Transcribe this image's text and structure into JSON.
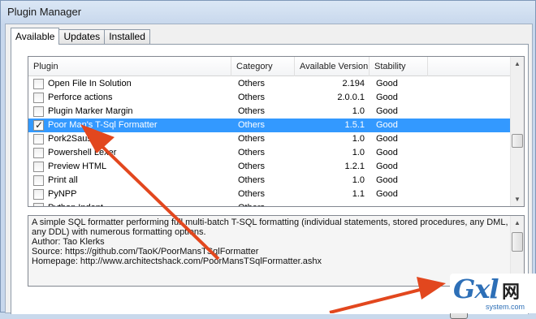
{
  "window": {
    "title": "Plugin Manager"
  },
  "tabs": [
    {
      "label": "Available",
      "active": true
    },
    {
      "label": "Updates",
      "active": false
    },
    {
      "label": "Installed",
      "active": false
    }
  ],
  "columns": [
    "Plugin",
    "Category",
    "Available Version",
    "Stability"
  ],
  "plugins": [
    {
      "name": "Open File In Solution",
      "category": "Others",
      "version": "2.194",
      "stability": "Good",
      "checked": false,
      "selected": false
    },
    {
      "name": "Perforce actions",
      "category": "Others",
      "version": "2.0.0.1",
      "stability": "Good",
      "checked": false,
      "selected": false
    },
    {
      "name": "Plugin Marker Margin",
      "category": "Others",
      "version": "1.0",
      "stability": "Good",
      "checked": false,
      "selected": false
    },
    {
      "name": "Poor Man's T-Sql Formatter",
      "category": "Others",
      "version": "1.5.1",
      "stability": "Good",
      "checked": true,
      "selected": true
    },
    {
      "name": "Pork2Sausage",
      "category": "Others",
      "version": "1.0",
      "stability": "Good",
      "checked": false,
      "selected": false
    },
    {
      "name": "Powershell Lexer",
      "category": "Others",
      "version": "1.0",
      "stability": "Good",
      "checked": false,
      "selected": false
    },
    {
      "name": "Preview HTML",
      "category": "Others",
      "version": "1.2.1",
      "stability": "Good",
      "checked": false,
      "selected": false
    },
    {
      "name": "Print all",
      "category": "Others",
      "version": "1.0",
      "stability": "Good",
      "checked": false,
      "selected": false
    },
    {
      "name": "PyNPP",
      "category": "Others",
      "version": "1.1",
      "stability": "Good",
      "checked": false,
      "selected": false
    },
    {
      "name": "Python Indent",
      "category": "Others",
      "version": "",
      "stability": "",
      "checked": false,
      "selected": false
    }
  ],
  "description": [
    "A simple SQL formatter performing full multi-batch T-SQL formatting (individual statements, stored procedures, any DML, any DDL) with numerous formatting options.",
    "Author: Tao Klerks",
    "Source: https://github.com/TaoK/PoorMansTSqlFormatter",
    "Homepage: http://www.architectshack.com/PoorMansTSqlFormatter.ashx"
  ],
  "watermark": {
    "logo": "Gxl",
    "net": "网",
    "sub": "system.com"
  },
  "colors": {
    "selection": "#3399ff",
    "arrow": "#e2471e"
  }
}
